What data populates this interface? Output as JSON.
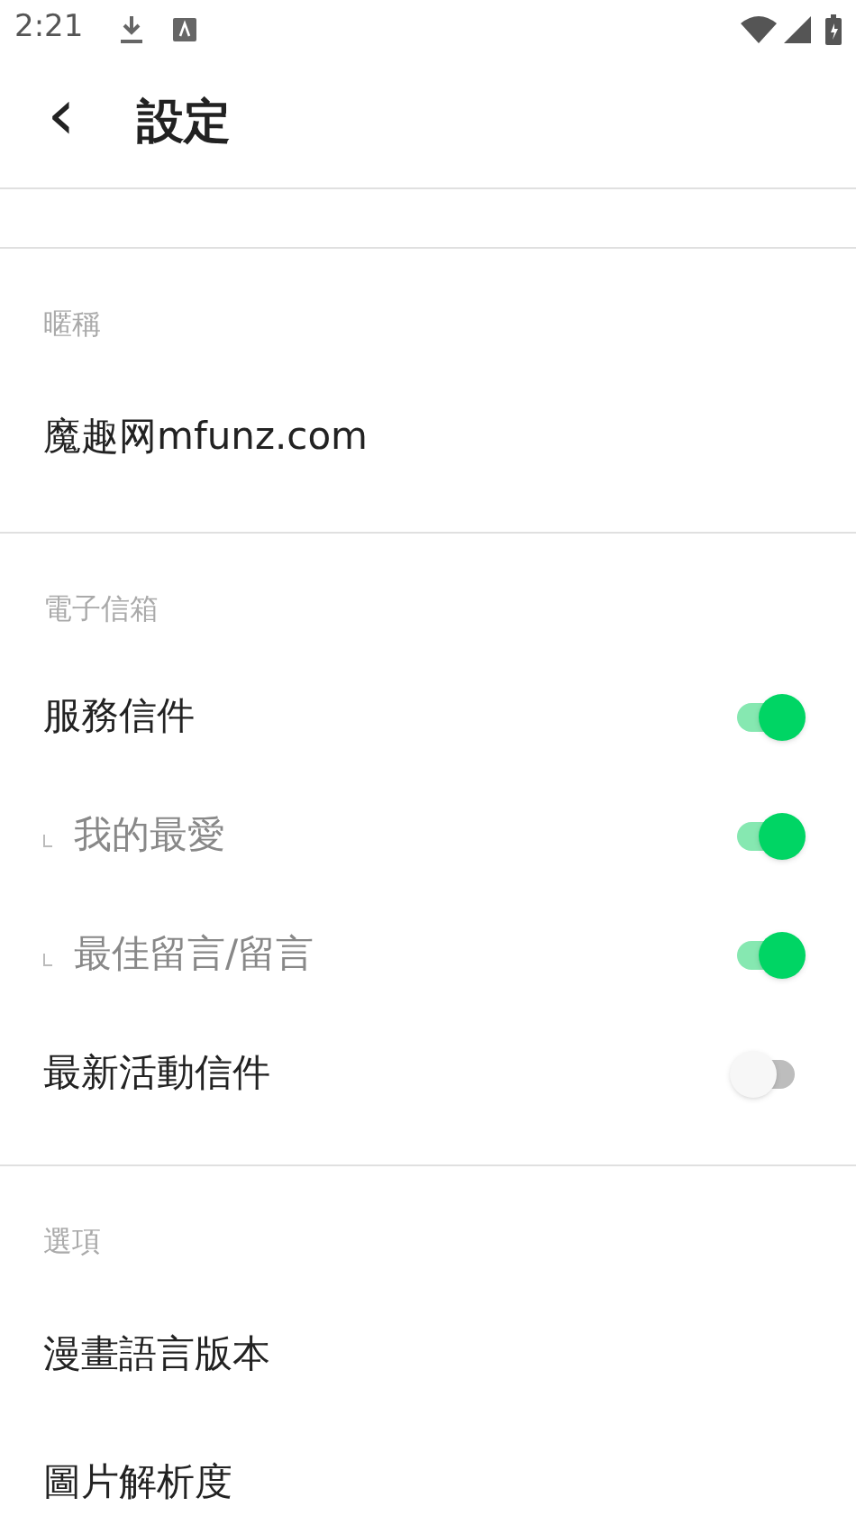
{
  "status_bar": {
    "time": "2:21"
  },
  "header": {
    "back": "‹",
    "title": "設定"
  },
  "sections": [
    {
      "label": "暱稱",
      "items": [
        {
          "kind": "text",
          "label": "魔趣网mfunz.com"
        }
      ]
    },
    {
      "label": "電子信箱",
      "items": [
        {
          "kind": "switch",
          "label": "服務信件",
          "on": true,
          "sub": false
        },
        {
          "kind": "switch",
          "label": "我的最愛",
          "on": true,
          "sub": true
        },
        {
          "kind": "switch",
          "label": "最佳留言/留言",
          "on": true,
          "sub": true
        },
        {
          "kind": "switch",
          "label": "最新活動信件",
          "on": false,
          "sub": false
        }
      ]
    },
    {
      "label": "選項",
      "items": [
        {
          "kind": "text",
          "label": "漫畫語言版本"
        },
        {
          "kind": "text",
          "label": "圖片解析度"
        }
      ]
    }
  ]
}
